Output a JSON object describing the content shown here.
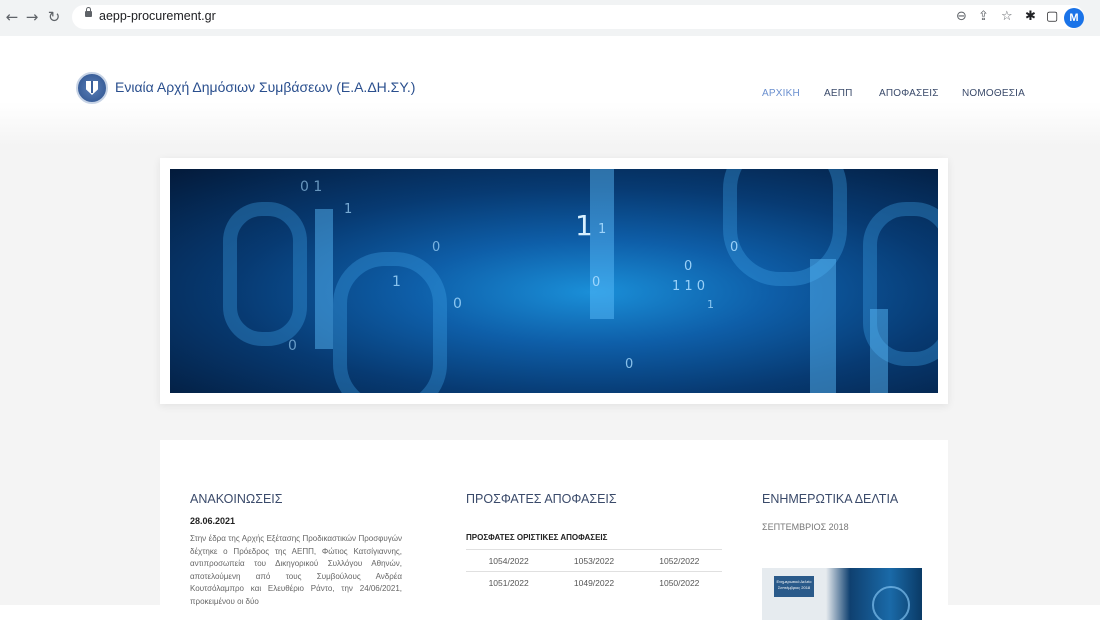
{
  "browser": {
    "url": "aepp-procurement.gr",
    "avatar_letter": "M",
    "icons": [
      "back-icon",
      "forward-icon",
      "reload-icon",
      "lock-icon",
      "zoom-icon",
      "share-icon",
      "star-icon",
      "extensions-icon",
      "sidebar-icon"
    ]
  },
  "header": {
    "site_title": "Ενιαία Αρχή Δημόσιων Συμβάσεων (Ε.Α.ΔΗ.ΣΥ.)",
    "nav": [
      {
        "label": "ΑΡΧΙΚΗ",
        "active": true
      },
      {
        "label": "ΑΕΠΠ",
        "active": false
      },
      {
        "label": "ΑΠΟΦΑΣΕΙΣ",
        "active": false
      },
      {
        "label": "ΝΟΜΟΘΕΣΙΑ",
        "active": false
      }
    ]
  },
  "announcements": {
    "title": "ΑΝΑΚΟΙΝΩΣΕΙΣ",
    "date": "28.06.2021",
    "text": "Στην έδρα της Αρχής Εξέτασης Προδικαστικών Προσφυγών δέχτηκε ο Πρόεδρος της ΑΕΠΠ, Φώτιος Κατσίγιαννης, αντιπροσωπεία του Δικηγορικού Συλλόγου Αθηνών, αποτελούμενη από τους Συμβούλους Ανδρέα Κουτσόλαμπρο και Ελευθέριο Ράντο, την 24/06/2021, προκειμένου οι δύο"
  },
  "decisions": {
    "title": "ΠΡΟΣΦΑΤΕΣ ΑΠΟΦΑΣΕΙΣ",
    "subtitle": "ΠΡΟΣΦΑΤΕΣ ΟΡΙΣΤΙΚΕΣ ΑΠΟΦΑΣΕΙΣ",
    "rows": [
      [
        "1054/2022",
        "1053/2022",
        "1052/2022"
      ],
      [
        "1051/2022",
        "1049/2022",
        "1050/2022"
      ]
    ]
  },
  "briefings": {
    "title": "ΕΝΗΜΕΡΩΤΙΚΑ ΔΕΛΤΙΑ",
    "date": "ΣΕΠΤΕΜΒΡΙΟΣ 2018",
    "thumb_label": "Ενημερωτικό Δελτίο Σεπτέμβριος 2018"
  },
  "colors": {
    "brand_blue": "#2a4f8e",
    "nav_active": "#6a8fcf",
    "hero_blue": "#0e5ea8"
  }
}
